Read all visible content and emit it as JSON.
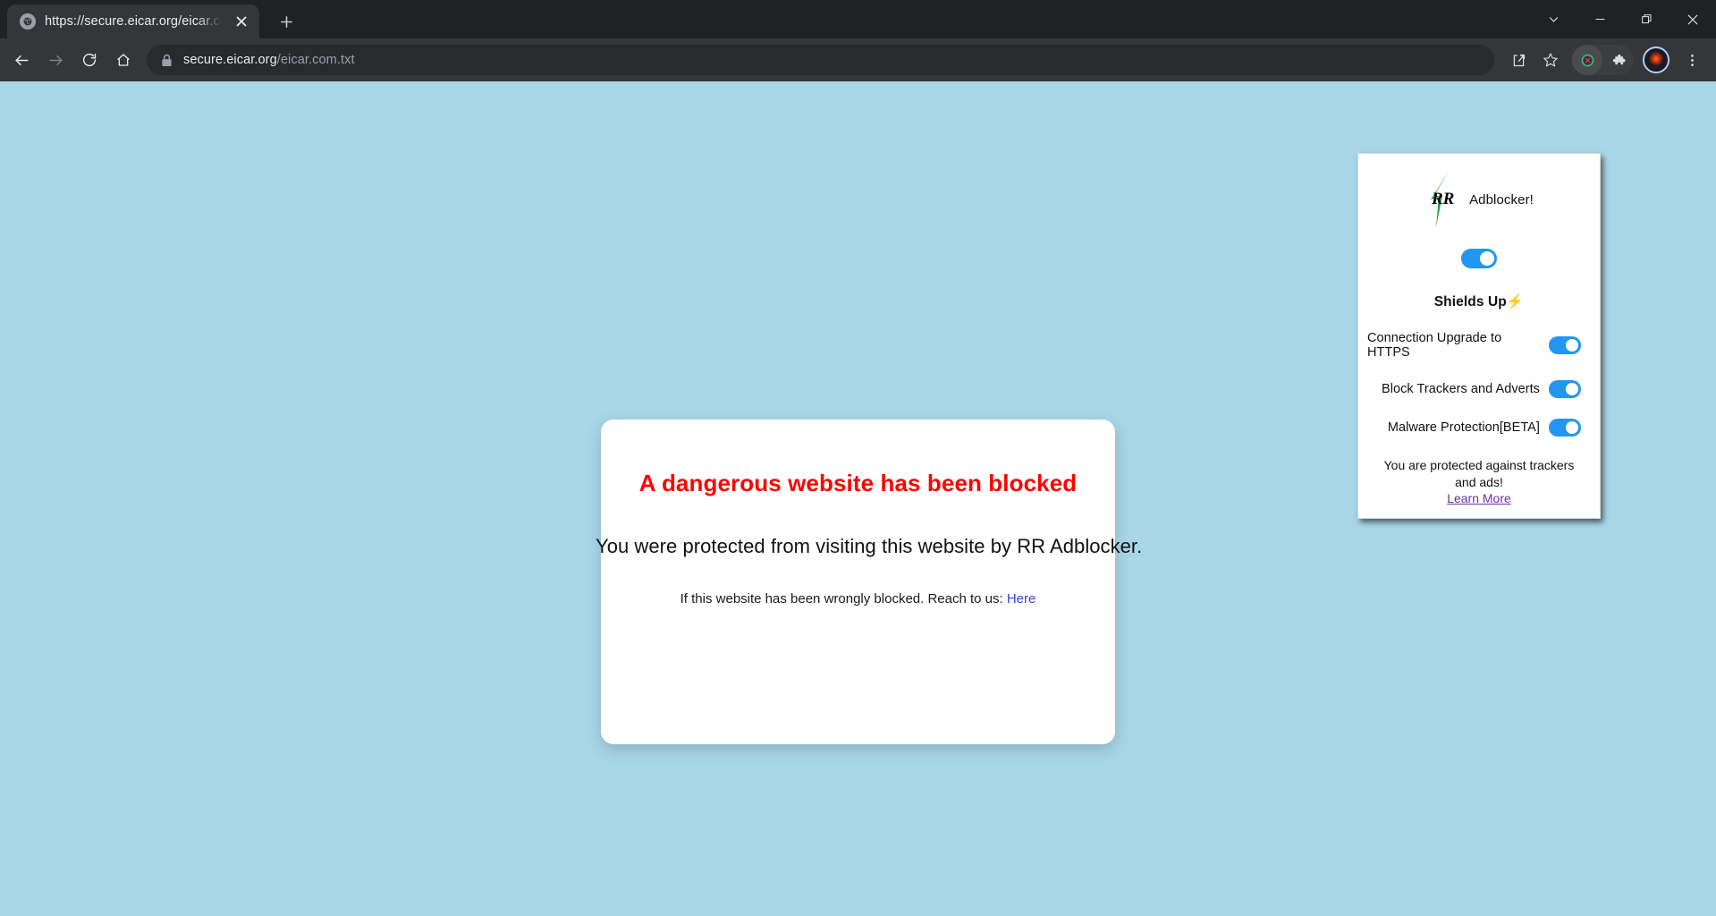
{
  "browser": {
    "tab": {
      "title": "https://secure.eicar.org/eicar.com",
      "favicon": "globe-icon",
      "close_label": "✕"
    },
    "newtab_label": "+",
    "window_controls": {
      "tab_search": "tab-search-chevron-icon",
      "minimize": "minimize-icon",
      "maximize": "maximize-restore-icon",
      "close": "close-window-icon"
    },
    "nav": {
      "back": "back-arrow-icon",
      "forward": "forward-arrow-icon",
      "reload": "reload-icon",
      "home": "home-icon"
    },
    "omnibox": {
      "lock": "lock-icon",
      "host": "secure.eicar.org",
      "path": "/eicar.com.txt",
      "full_url": "secure.eicar.org/eicar.com.txt"
    },
    "toolbar_icons": {
      "share": "share-icon",
      "bookmark": "star-bookmark-icon",
      "active_extension": "rr-adblocker-shield-icon",
      "extensions": "puzzle-piece-icon",
      "profile": "profile-avatar-icon",
      "menu": "three-dot-menu-icon"
    }
  },
  "page": {
    "background_color": "#a9d7e8",
    "card": {
      "title": "A dangerous website has been blocked",
      "title_color": "#ff0000",
      "subtitle": "You were protected from visiting this website by RR Adblocker.",
      "note_prefix": "If this website has been wrongly blocked. Reach to us: ",
      "note_link": "Here",
      "note_link_color": "#3a44d8"
    }
  },
  "extension_popup": {
    "brand": "Adblocker!",
    "logo": "rr-lightning-bolt-logo",
    "logo_color": "#1a9e3c",
    "master_toggle": {
      "state": "on",
      "accent": "#2196f3"
    },
    "shields_heading": "Shields Up",
    "shields_bolt": "⚡",
    "settings": [
      {
        "label": "Connection Upgrade to HTTPS",
        "state": "on"
      },
      {
        "label": "Block Trackers and Adverts",
        "state": "on"
      },
      {
        "label": "Malware Protection[BETA]",
        "state": "on"
      }
    ],
    "footer_text": "You are protected against trackers and ads!",
    "footer_link": "Learn More",
    "footer_link_color": "#7030a0"
  }
}
